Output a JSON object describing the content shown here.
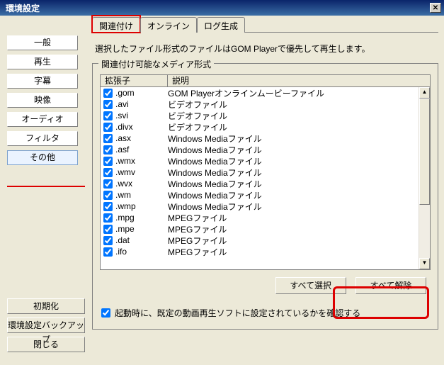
{
  "window": {
    "title": "環境設定"
  },
  "sidebar": {
    "items": [
      {
        "label": "一般"
      },
      {
        "label": "再生"
      },
      {
        "label": "字幕"
      },
      {
        "label": "映像"
      },
      {
        "label": "オーディオ"
      },
      {
        "label": "フィルタ"
      },
      {
        "label": "その他",
        "selected": true
      }
    ]
  },
  "bottom": {
    "init": "初期化",
    "backup": "環境設定バックアップ",
    "close": "閉じる"
  },
  "tabs": {
    "items": [
      {
        "label": "関連付け",
        "active": true
      },
      {
        "label": "オンライン"
      },
      {
        "label": "ログ生成"
      }
    ]
  },
  "description": "選択したファイル形式のファイルはGOM Playerで優先して再生します。",
  "group": {
    "title": "関連付け可能なメディア形式",
    "columns": {
      "ext": "拡張子",
      "desc": "説明"
    },
    "rows": [
      {
        "ext": ".gom",
        "desc": "GOM Playerオンラインムービーファイル"
      },
      {
        "ext": ".avi",
        "desc": "ビデオファイル"
      },
      {
        "ext": ".svi",
        "desc": "ビデオファイル"
      },
      {
        "ext": ".divx",
        "desc": "ビデオファイル"
      },
      {
        "ext": ".asx",
        "desc": "Windows Mediaファイル"
      },
      {
        "ext": ".asf",
        "desc": "Windows Mediaファイル"
      },
      {
        "ext": ".wmx",
        "desc": "Windows Mediaファイル"
      },
      {
        "ext": ".wmv",
        "desc": "Windows Mediaファイル"
      },
      {
        "ext": ".wvx",
        "desc": "Windows Mediaファイル"
      },
      {
        "ext": ".wm",
        "desc": "Windows Mediaファイル"
      },
      {
        "ext": ".wmp",
        "desc": "Windows Mediaファイル"
      },
      {
        "ext": ".mpg",
        "desc": "MPEGファイル"
      },
      {
        "ext": ".mpe",
        "desc": "MPEGファイル"
      },
      {
        "ext": ".dat",
        "desc": "MPEGファイル"
      },
      {
        "ext": ".ifo",
        "desc": "MPEGファイル"
      }
    ],
    "select_all": "すべて選択",
    "deselect_all": "すべて解除"
  },
  "startup_check": "起動時に、既定の動画再生ソフトに設定されているかを確認する"
}
